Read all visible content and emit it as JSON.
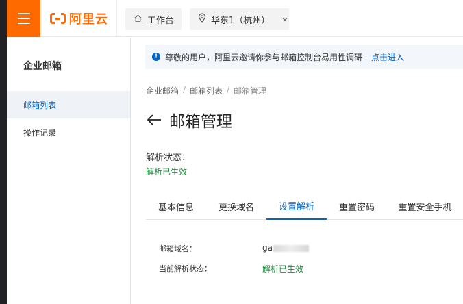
{
  "topbar": {
    "logo_text": "阿里云",
    "workbench_label": "工作台",
    "region_label": "华东1（杭州）",
    "accent_color": "#ff6a00"
  },
  "sidebar": {
    "title": "企业邮箱",
    "items": [
      {
        "label": "邮箱列表",
        "active": true
      },
      {
        "label": "操作记录",
        "active": false
      }
    ]
  },
  "notice": {
    "text": "尊敬的用户，阿里云邀请你参与邮箱控制台易用性调研",
    "link": "点击进入"
  },
  "breadcrumb": [
    "企业邮箱",
    "邮箱列表",
    "邮箱管理"
  ],
  "page": {
    "title": "邮箱管理",
    "status_label": "解析状态：",
    "status_value": "解析已生效"
  },
  "tabs": [
    {
      "label": "基本信息",
      "active": false
    },
    {
      "label": "更换域名",
      "active": false
    },
    {
      "label": "设置解析",
      "active": true
    },
    {
      "label": "重置密码",
      "active": false
    },
    {
      "label": "重置安全手机",
      "active": false
    }
  ],
  "details": {
    "domain_label": "邮箱域名：",
    "domain_value": "ga",
    "resolve_label": "当前解析状态：",
    "resolve_value": "解析已生效"
  }
}
